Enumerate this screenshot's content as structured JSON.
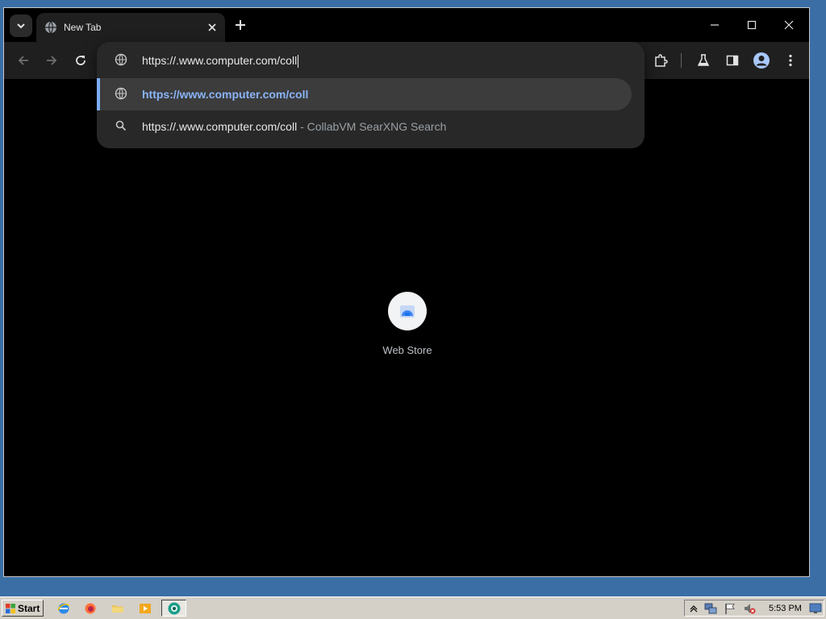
{
  "tab": {
    "title": "New Tab"
  },
  "omnibox": {
    "value": "https://.www.computer.com/coll"
  },
  "suggestions": [
    {
      "text": "https://www.computer.com/coll",
      "selected": true
    },
    {
      "text": "https://.www.computer.com/coll",
      "separator": " - ",
      "engine": "CollabVM SearXNG Search",
      "selected": false
    }
  ],
  "shortcuts": [
    {
      "label": "Web Store"
    }
  ],
  "taskbar": {
    "start_label": "Start",
    "clock": "5:53 PM"
  },
  "colors": {
    "accent": "#7cacf8",
    "link": "#8ab4f8",
    "desktop": "#3a6ea5"
  }
}
